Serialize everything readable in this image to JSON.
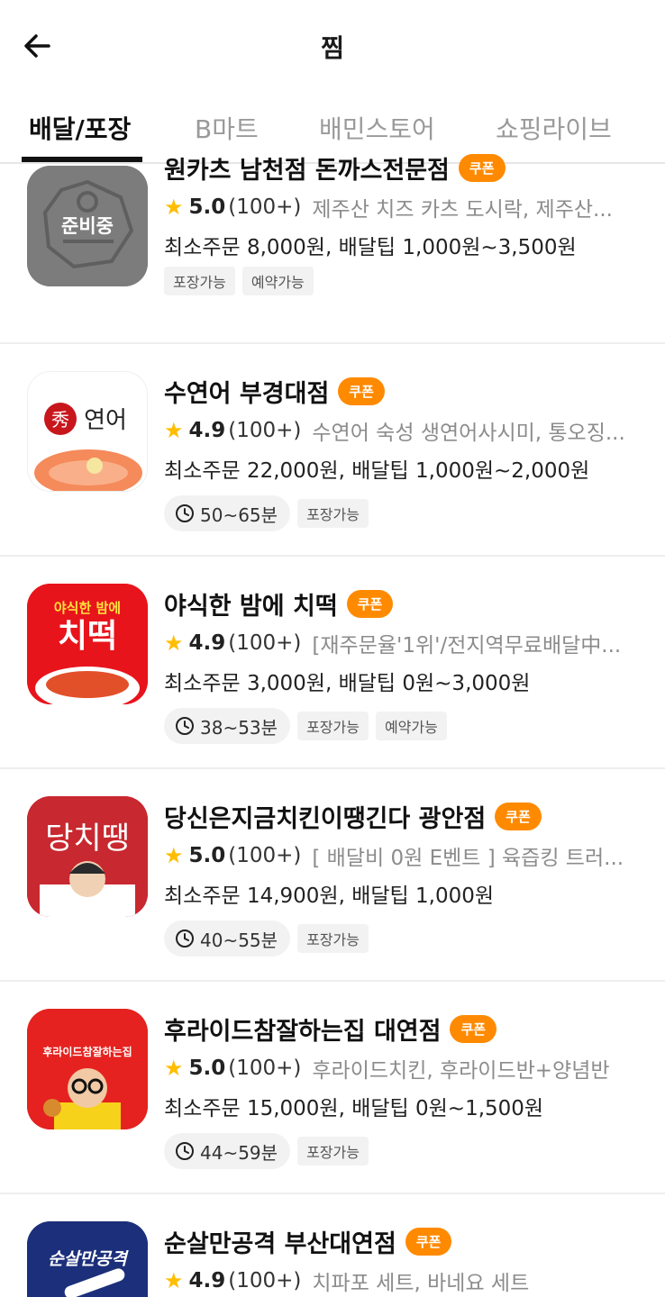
{
  "header": {
    "title": "찜",
    "back_icon": "arrow-left-icon"
  },
  "tabs": [
    {
      "label": "배달/포장",
      "active": true
    },
    {
      "label": "B마트",
      "active": false
    },
    {
      "label": "배민스토어",
      "active": false
    },
    {
      "label": "쇼핑라이브",
      "active": false
    }
  ],
  "stores": [
    {
      "name": "원카츠 남천점 돈까스전문점",
      "coupon": "쿠폰",
      "rating": "5.0",
      "reviews": "(100+)",
      "menu": "제주산 치즈 카츠 도시락, 제주산...",
      "order_info": "최소주문 8,000원, 배달팁 1,000원~3,500원",
      "time": "",
      "tags": [
        "포장가능",
        "예약가능"
      ],
      "thumb_text": "준비중"
    },
    {
      "name": "수연어 부경대점",
      "coupon": "쿠폰",
      "rating": "4.9",
      "reviews": "(100+)",
      "menu": "수연어 숙성 생연어사시미, 통오징...",
      "order_info": "최소주문 22,000원, 배달팁 1,000원~2,000원",
      "time": "50~65분",
      "tags": [
        "포장가능"
      ],
      "thumb_text": "秀연어"
    },
    {
      "name": "야식한 밤에 치떡",
      "coupon": "쿠폰",
      "rating": "4.9",
      "reviews": "(100+)",
      "menu": "[재주문율'1위'/전지역무료배달中...",
      "order_info": "최소주문 3,000원, 배달팁 0원~3,000원",
      "time": "38~53분",
      "tags": [
        "포장가능",
        "예약가능"
      ],
      "thumb_text_top": "야식한 밤에",
      "thumb_text": "치떡"
    },
    {
      "name": "당신은지금치킨이땡긴다 광안점",
      "coupon": "쿠폰",
      "rating": "5.0",
      "reviews": "(100+)",
      "menu": "[ 배달비 0원 E벤트 ] 육즙킹 트러...",
      "order_info": "최소주문 14,900원, 배달팁 1,000원",
      "time": "40~55분",
      "tags": [
        "포장가능"
      ],
      "thumb_text": "당치땡"
    },
    {
      "name": "후라이드참잘하는집 대연점",
      "coupon": "쿠폰",
      "rating": "5.0",
      "reviews": "(100+)",
      "menu": "후라이드치킨, 후라이드반+양념반",
      "order_info": "최소주문 15,000원, 배달팁 0원~1,500원",
      "time": "44~59분",
      "tags": [
        "포장가능"
      ],
      "thumb_text": "후라이드참잘하는집"
    },
    {
      "name": "순살만공격 부산대연점",
      "coupon": "쿠폰",
      "rating": "4.9",
      "reviews": "(100+)",
      "menu": "치파포 세트, 바네요 세트",
      "order_info": "",
      "time": "",
      "tags": [],
      "thumb_text": "순살만공격"
    }
  ],
  "colors": {
    "coupon": "#ff8a00",
    "star": "#ffbd00",
    "accent": "#111111"
  }
}
